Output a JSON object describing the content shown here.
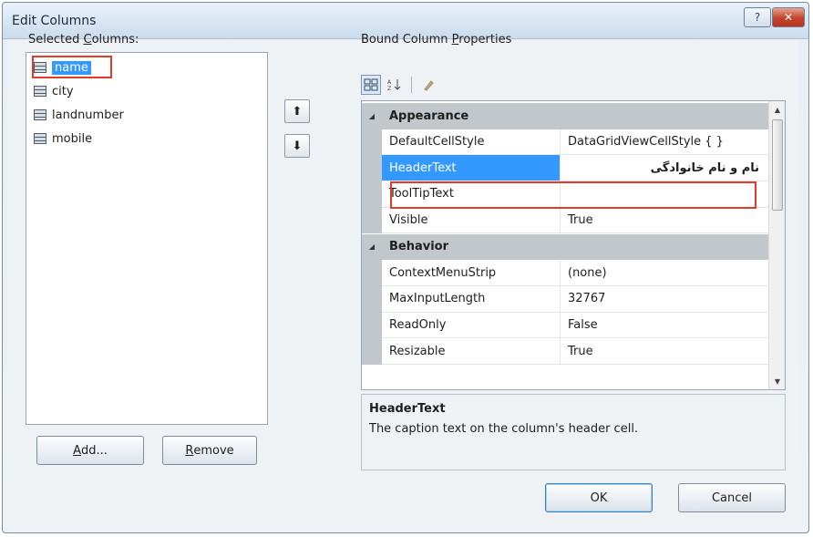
{
  "window": {
    "title": "Edit Columns",
    "help_glyph": "?",
    "close_glyph": "✕"
  },
  "selected_columns": {
    "label_pre": "Selected ",
    "label_key": "C",
    "label_post": "olumns:",
    "items": [
      {
        "text": "name",
        "selected": true
      },
      {
        "text": "city"
      },
      {
        "text": "landnumber"
      },
      {
        "text": "mobile"
      }
    ],
    "move_up_glyph": "⬆",
    "move_down_glyph": "⬇"
  },
  "buttons": {
    "add": {
      "key": "A",
      "rest": "dd..."
    },
    "remove": {
      "key": "R",
      "rest": "emove"
    },
    "ok": "OK",
    "cancel": "Cancel"
  },
  "properties": {
    "label_pre": "Bound Column ",
    "label_key": "P",
    "label_post": "roperties",
    "toolbar": {
      "categorized_icon": "categorized-icon",
      "alphabetical_icon": "alphabetical-icon",
      "property_pages_icon": "property-pages-icon"
    },
    "categories": [
      {
        "name": "Appearance",
        "props": [
          {
            "name": "DefaultCellStyle",
            "value": "DataGridViewCellStyle { }"
          },
          {
            "name": "HeaderText",
            "value": "نام و نام خانوادگی",
            "selected": true
          },
          {
            "name": "ToolTipText",
            "value": ""
          },
          {
            "name": "Visible",
            "value": "True"
          }
        ]
      },
      {
        "name": "Behavior",
        "props": [
          {
            "name": "ContextMenuStrip",
            "value": "(none)"
          },
          {
            "name": "MaxInputLength",
            "value": "32767"
          },
          {
            "name": "ReadOnly",
            "value": "False"
          },
          {
            "name": "Resizable",
            "value": "True"
          }
        ]
      }
    ],
    "description": {
      "title": "HeaderText",
      "text": "The caption text on the column's header cell."
    }
  },
  "colors": {
    "selection": "#3399ff",
    "highlight_outline": "#e23b2a",
    "category_bg": "#c2c7cc"
  }
}
